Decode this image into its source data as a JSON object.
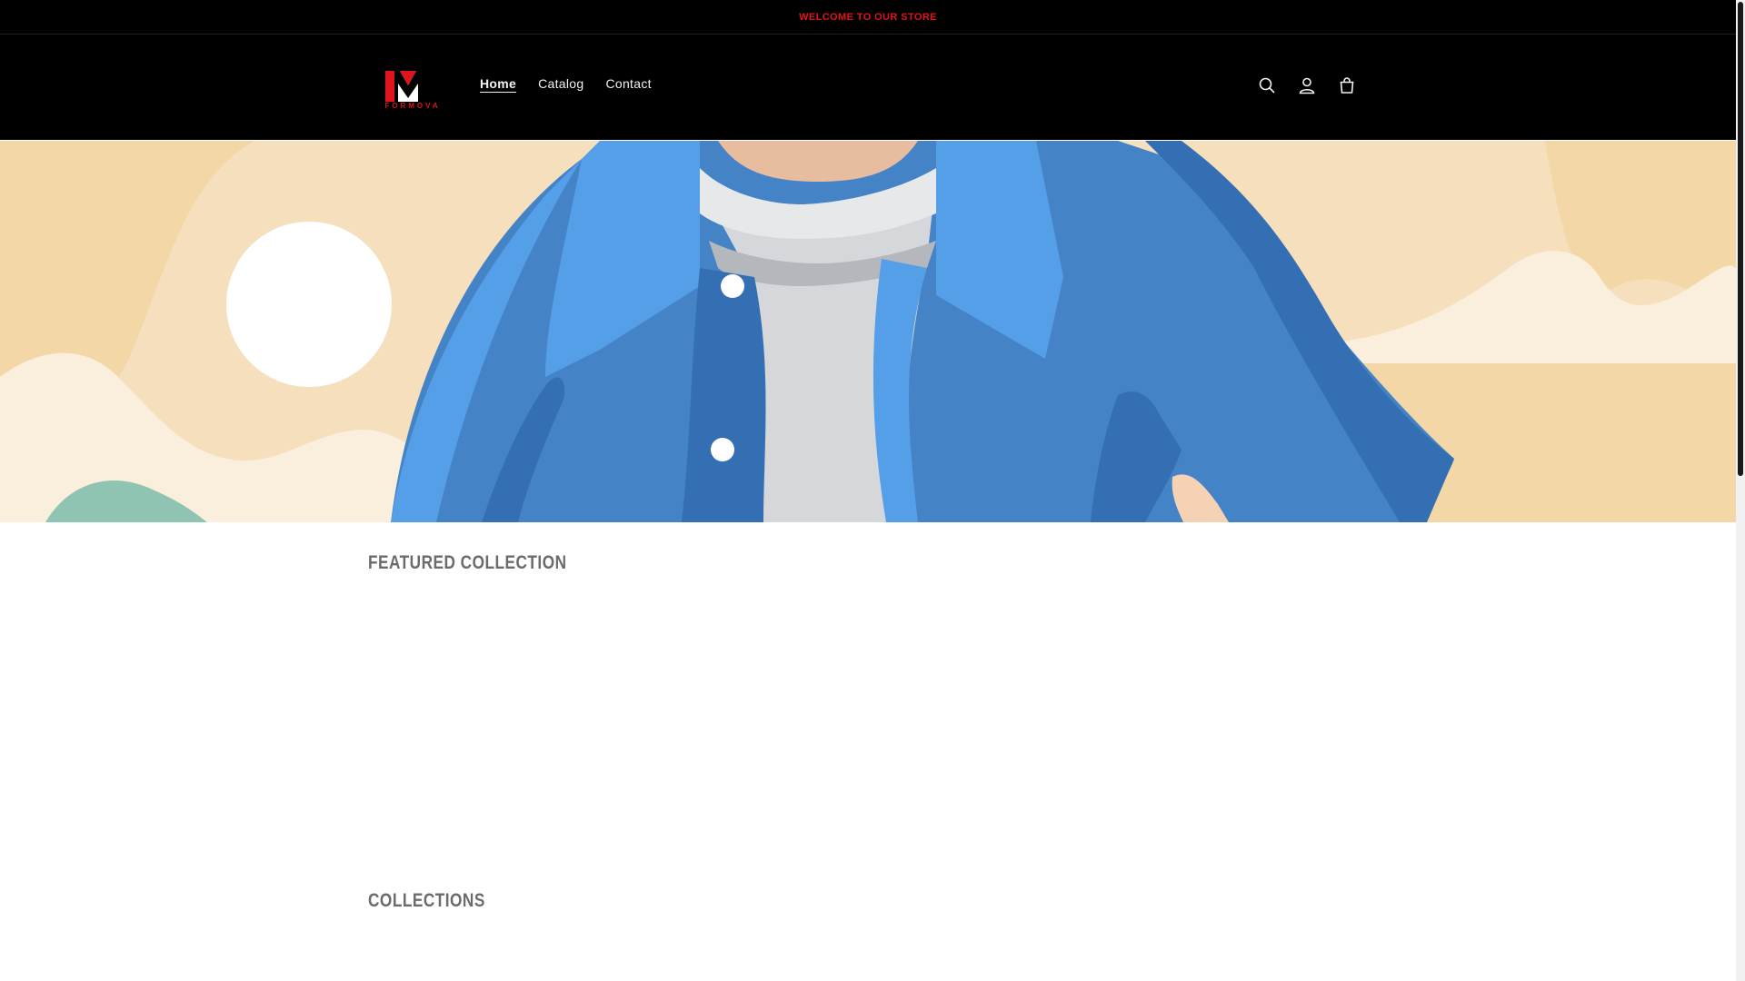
{
  "announcement": {
    "text": "WELCOME TO OUR STORE"
  },
  "header": {
    "logo_text": "FORMOVA",
    "nav": [
      {
        "label": "Home",
        "active": true
      },
      {
        "label": "Catalog",
        "active": false
      },
      {
        "label": "Contact",
        "active": false
      }
    ],
    "icons": [
      "search-icon",
      "account-icon",
      "cart-icon"
    ]
  },
  "sections": {
    "featured_title": "Featured collection",
    "collections_title": "Collections"
  },
  "colors": {
    "announcement_text": "#e0141b",
    "header_bg": "#000000",
    "hero_bg": "#f5dfbc",
    "jacket": "#4483c6",
    "jacket_light": "#559ee8"
  }
}
